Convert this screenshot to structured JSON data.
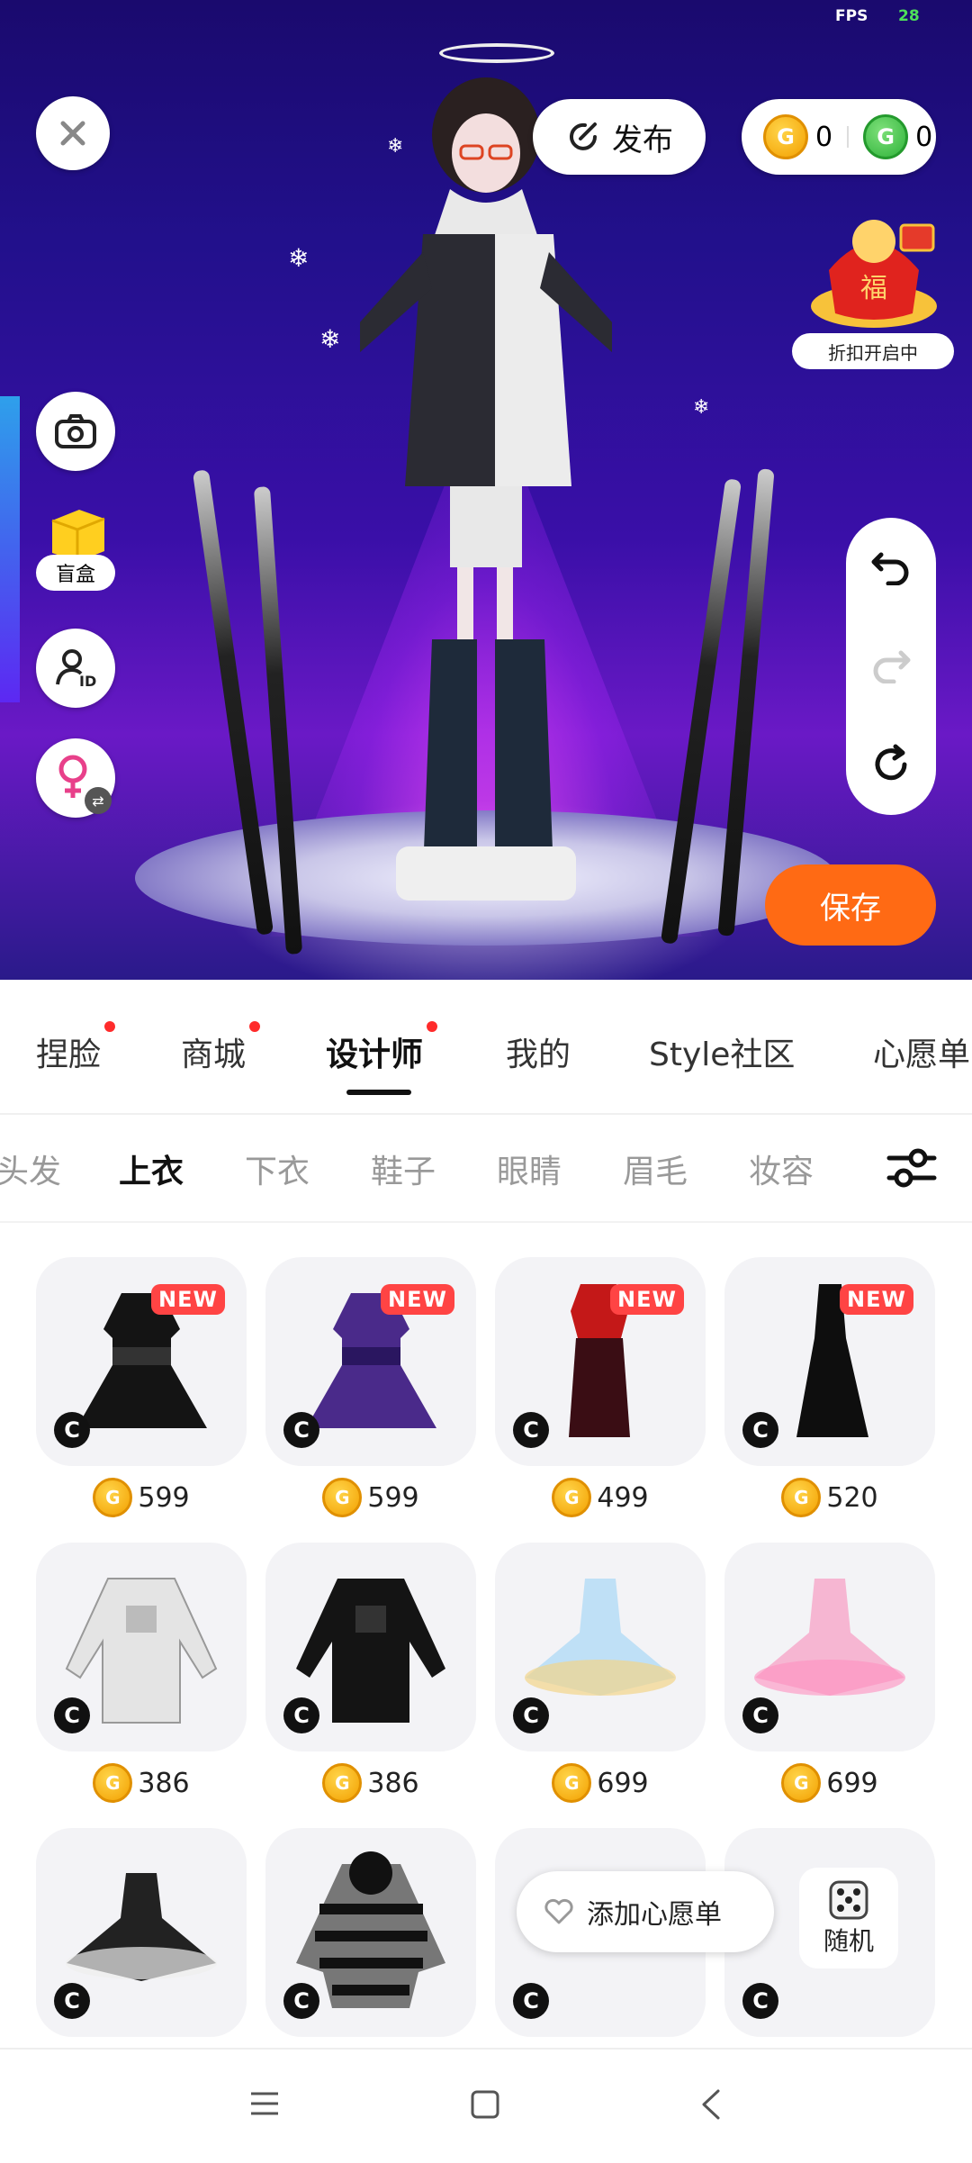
{
  "status": {
    "fps_label": "FPS",
    "fps_value": "28"
  },
  "top_bar": {
    "publish_label": "发布",
    "gold_coins": "0",
    "green_coins": "0"
  },
  "promo": {
    "label": "折扣开启中",
    "icon_text": "福"
  },
  "left_tools": {
    "blind_box_label": "盲盒"
  },
  "save_label": "保存",
  "tabs": [
    {
      "label": "捏脸",
      "dot": true
    },
    {
      "label": "商城",
      "dot": true
    },
    {
      "label": "设计师",
      "dot": true,
      "active": true
    },
    {
      "label": "我的",
      "dot": false
    },
    {
      "label": "Style社区",
      "dot": false
    },
    {
      "label": "心愿单",
      "dot": false
    }
  ],
  "categories": [
    "头发",
    "上衣",
    "下衣",
    "鞋子",
    "眼睛",
    "眉毛",
    "妆容"
  ],
  "active_category": "上衣",
  "items": [
    {
      "price": "599",
      "new": true,
      "new_label": "NEW"
    },
    {
      "price": "599",
      "new": true,
      "new_label": "NEW"
    },
    {
      "price": "499",
      "new": true,
      "new_label": "NEW"
    },
    {
      "price": "520",
      "new": true,
      "new_label": "NEW"
    },
    {
      "price": "386",
      "new": false
    },
    {
      "price": "386",
      "new": false
    },
    {
      "price": "699",
      "new": false
    },
    {
      "price": "699",
      "new": false
    },
    {
      "price": "",
      "new": false
    },
    {
      "price": "",
      "new": false
    },
    {
      "price": "",
      "new": false
    },
    {
      "price": "",
      "new": false
    }
  ],
  "creator_badge": "C",
  "coin_glyph": "G",
  "wishlist_label": "添加心愿单",
  "random_label": "随机",
  "colors": {
    "accent": "#ff6a14",
    "new_badge": "#ff4444",
    "gold": "#f3a000",
    "green": "#2fb33a"
  }
}
